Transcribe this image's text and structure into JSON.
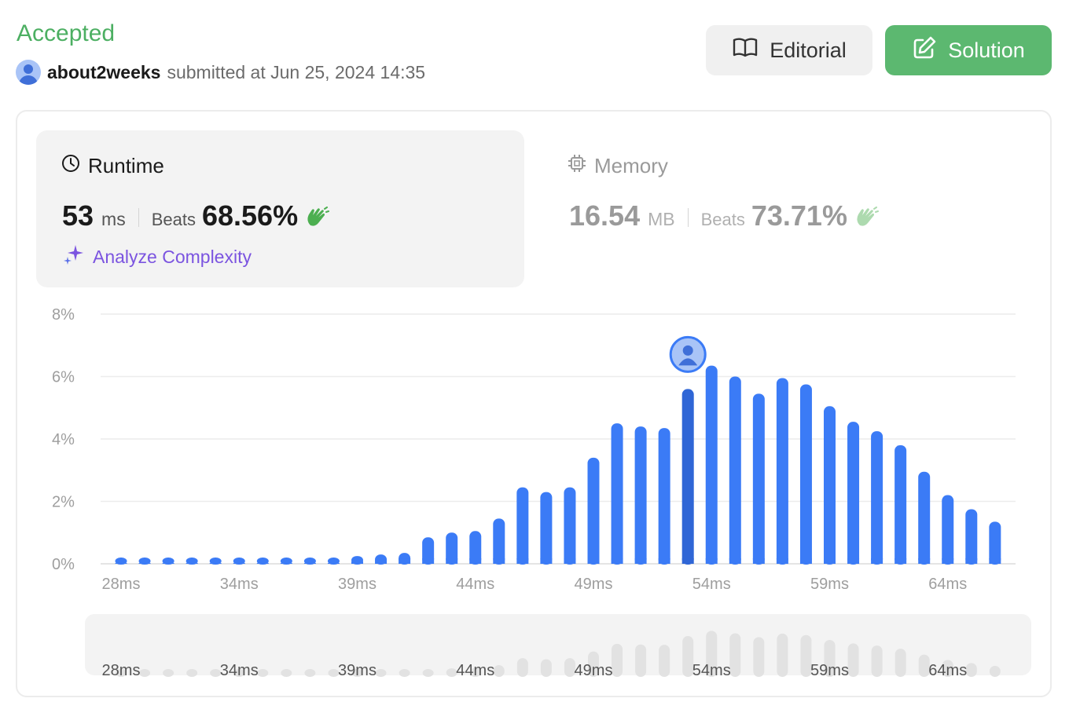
{
  "status": {
    "label": "Accepted",
    "color": "#4caf62"
  },
  "submission": {
    "username": "about2weeks",
    "submitted_text": "submitted at Jun 25, 2024 14:35"
  },
  "buttons": {
    "editorial_label": "Editorial",
    "solution_label": "Solution"
  },
  "runtime": {
    "title": "Runtime",
    "value": "53",
    "unit": "ms",
    "beats_label": "Beats",
    "beats_pct": "68.56%",
    "analyze_label": "Analyze Complexity"
  },
  "memory": {
    "title": "Memory",
    "value": "16.54",
    "unit": "MB",
    "beats_label": "Beats",
    "beats_pct": "73.71%"
  },
  "colors": {
    "accent_green": "#5cb870",
    "bar_blue": "#3b7bf6",
    "bar_highlight": "#2f66d6",
    "analyze_purple": "#7b54e0"
  },
  "chart_data": {
    "type": "bar",
    "title": "",
    "xlabel": "",
    "ylabel": "",
    "ylim": [
      0,
      8
    ],
    "y_ticks": [
      "0%",
      "2%",
      "4%",
      "6%",
      "8%"
    ],
    "x_ticks": [
      "28ms",
      "34ms",
      "39ms",
      "44ms",
      "49ms",
      "54ms",
      "59ms",
      "64ms"
    ],
    "grid": true,
    "highlight_index": 24,
    "values": [
      0.2,
      0.2,
      0.2,
      0.2,
      0.2,
      0.2,
      0.2,
      0.2,
      0.2,
      0.2,
      0.25,
      0.3,
      0.35,
      0.85,
      1.0,
      1.05,
      1.45,
      2.45,
      2.3,
      2.45,
      3.4,
      4.5,
      4.4,
      4.35,
      5.6,
      6.35,
      6.0,
      5.45,
      5.95,
      5.75,
      5.05,
      4.55,
      4.25,
      3.8,
      2.95,
      2.2,
      1.75,
      1.35
    ],
    "mini_ticks": [
      "28ms",
      "34ms",
      "39ms",
      "44ms",
      "49ms",
      "54ms",
      "59ms",
      "64ms"
    ]
  }
}
